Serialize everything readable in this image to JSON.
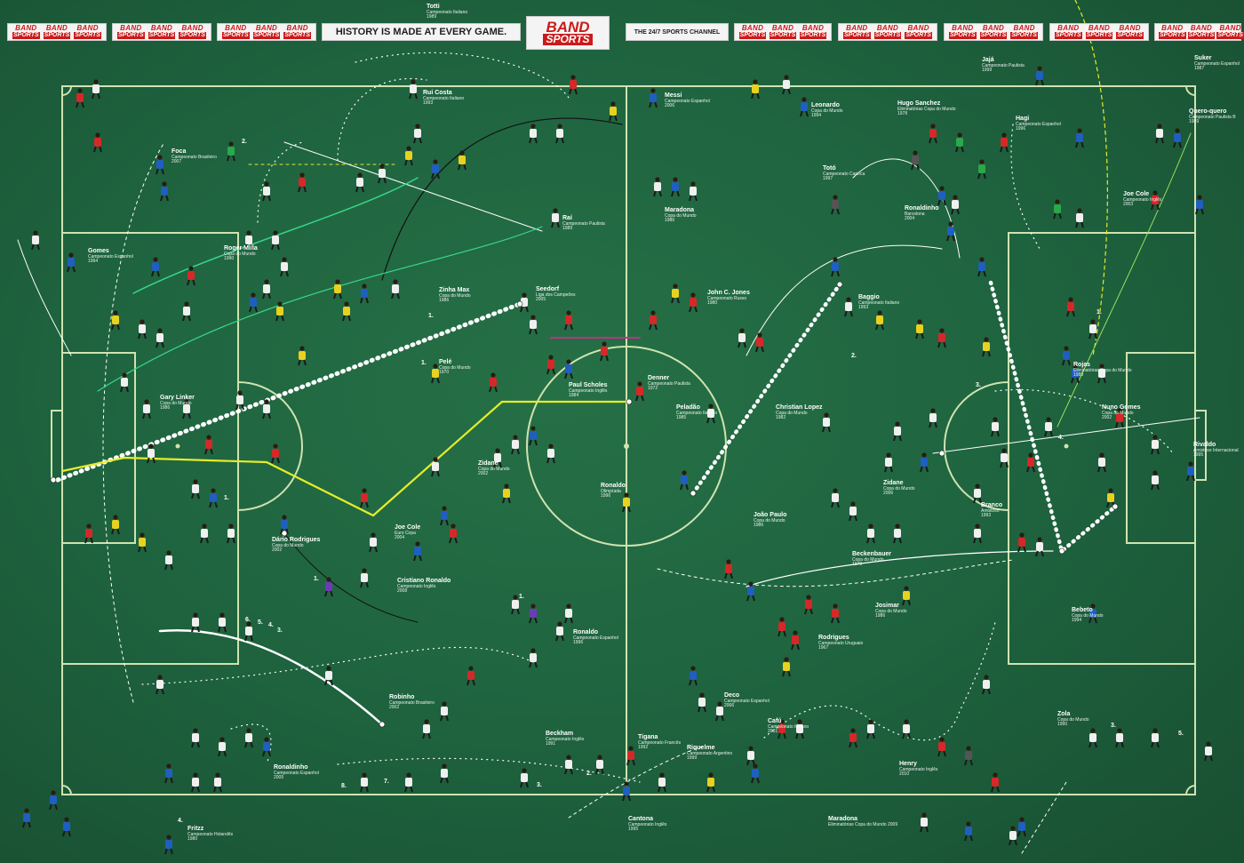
{
  "header": {
    "tagline_left": "HISTORY IS MADE AT EVERY GAME.",
    "tagline_right": "THE 24/7 SPORTS CHANNEL",
    "brand_top": "BAND",
    "brand_bottom": "SPORTS",
    "brand_color": "#cc1a1a"
  },
  "colors": {
    "pitch": "#1f6540",
    "lines": "#cfe3b0",
    "pass_white": "#ffffff",
    "pass_yellow": "#e6ec2a"
  },
  "labels": [
    {
      "id": "totti",
      "name": "Totti",
      "comp": "Campeonato Italiano",
      "year": "1989"
    },
    {
      "id": "rui-costa",
      "name": "Rui Costa",
      "comp": "Campeonato Italiano",
      "year": "1993"
    },
    {
      "id": "messi",
      "name": "Messi",
      "comp": "Campeonato Espanhol",
      "year": "2006"
    },
    {
      "id": "leonardo",
      "name": "Leonardo",
      "comp": "Copa do Mundo",
      "year": "1994"
    },
    {
      "id": "hugo-sanchez",
      "name": "Hugo Sanchez",
      "comp": "Eliminatórias Copa do Mundo",
      "year": "1978"
    },
    {
      "id": "hagi",
      "name": "Hagi",
      "comp": "Campeonato Espanhol",
      "year": "1996"
    },
    {
      "id": "jaja",
      "name": "Jajá",
      "comp": "Campeonato Paulista",
      "year": "1999"
    },
    {
      "id": "suker",
      "name": "Suker",
      "comp": "Campeonato Espanhol",
      "year": "1987"
    },
    {
      "id": "quero-quero",
      "name": "Quero-quero",
      "comp": "Campeonato Paulista B",
      "year": "1989"
    },
    {
      "id": "foca",
      "name": "Foca",
      "comp": "Campeonato Brasileiro",
      "year": "2007"
    },
    {
      "id": "toto",
      "name": "Totó",
      "comp": "Campeonato Carioca",
      "year": "1997"
    },
    {
      "id": "rai",
      "name": "Raí",
      "comp": "Campeonato Paulista",
      "year": "1989"
    },
    {
      "id": "maradona-1986",
      "name": "Maradona",
      "comp": "Copa do Mundo",
      "year": "1986"
    },
    {
      "id": "ronaldinho-barcelona",
      "name": "Ronaldinho",
      "comp": "Barcelona",
      "year": "2004"
    },
    {
      "id": "joe-cole-ingles",
      "name": "Joe Cole",
      "comp": "Campeonato Inglês",
      "year": "2003"
    },
    {
      "id": "gomes",
      "name": "Gomes",
      "comp": "Campeonato Espanhol",
      "year": "1994"
    },
    {
      "id": "roger-milla",
      "name": "Roger Milla",
      "comp": "Copa do Mundo",
      "year": "1990"
    },
    {
      "id": "zinha-max",
      "name": "Zinha Max",
      "comp": "Copa do Mundo",
      "year": "1986"
    },
    {
      "id": "seedorf",
      "name": "Seedorf",
      "comp": "Liga dos Campeões",
      "year": "2005"
    },
    {
      "id": "john-c-jones",
      "name": "John C. Jones",
      "comp": "Campeonato Russo",
      "year": "1980"
    },
    {
      "id": "baggio",
      "name": "Baggio",
      "comp": "Campeonato Italiano",
      "year": "1993"
    },
    {
      "id": "pele",
      "name": "Pelé",
      "comp": "Copa do Mundo",
      "year": "1970"
    },
    {
      "id": "paul-scholes",
      "name": "Paul Scholes",
      "comp": "Campeonato Inglês",
      "year": "1984"
    },
    {
      "id": "denner",
      "name": "Denner",
      "comp": "Campeonato Paulista",
      "year": "1972"
    },
    {
      "id": "peladao",
      "name": "Peladão",
      "comp": "Campeonato Italiano",
      "year": "1985"
    },
    {
      "id": "christian-lopez",
      "name": "Christian Lopez",
      "comp": "Copa do Mundo",
      "year": "1982"
    },
    {
      "id": "rojas",
      "name": "Rojas",
      "comp": "Eliminatórias Copa do Mundo",
      "year": "1989"
    },
    {
      "id": "nuno-gomes",
      "name": "Nuno Gomes",
      "comp": "Copa do Mundo",
      "year": "2002"
    },
    {
      "id": "gary-linker",
      "name": "Gary Linker",
      "comp": "Copa do Mundo",
      "year": "1986"
    },
    {
      "id": "zidane-2002",
      "name": "Zidane",
      "comp": "Copa do Mundo",
      "year": "2002"
    },
    {
      "id": "ronaldo-olimpiada",
      "name": "Ronaldo",
      "comp": "Olimpíada",
      "year": "1996"
    },
    {
      "id": "zidane-2006",
      "name": "Zidane",
      "comp": "Copa do Mundo",
      "year": "2006"
    },
    {
      "id": "branco",
      "name": "Branco",
      "comp": "Amistoso",
      "year": "1993"
    },
    {
      "id": "rivaldo",
      "name": "Rivaldo",
      "comp": "Amistoso Internacional",
      "year": "1995"
    },
    {
      "id": "joao-paulo",
      "name": "João Paulo",
      "comp": "Copa do Mundo",
      "year": "1986"
    },
    {
      "id": "dario-rodrigues",
      "name": "Dário Rodrigues",
      "comp": "Copa do Mundo",
      "year": "2002"
    },
    {
      "id": "joe-cole-euro",
      "name": "Joe Cole",
      "comp": "Euro Copa",
      "year": "2004"
    },
    {
      "id": "beckenbauer",
      "name": "Beckenbauer",
      "comp": "Copa do Mundo",
      "year": "1970"
    },
    {
      "id": "cristiano-ronaldo",
      "name": "Cristiano Ronaldo",
      "comp": "Campeonato Inglês",
      "year": "2008"
    },
    {
      "id": "josimar",
      "name": "Josimar",
      "comp": "Copa do Mundo",
      "year": "1986"
    },
    {
      "id": "rodrigues",
      "name": "Rodrigues",
      "comp": "Campeonato Uruguaio",
      "year": "1967"
    },
    {
      "id": "ronaldo-espanhol",
      "name": "Ronaldo",
      "comp": "Campeonato Espanhol",
      "year": "1996"
    },
    {
      "id": "bebeto",
      "name": "Bebeto",
      "comp": "Copa do Mundo",
      "year": "1994"
    },
    {
      "id": "robinho",
      "name": "Robinho",
      "comp": "Campeonato Brasileiro",
      "year": "2002"
    },
    {
      "id": "deco",
      "name": "Deco",
      "comp": "Campeonato Espanhol",
      "year": "2006"
    },
    {
      "id": "cafu",
      "name": "Cafú",
      "comp": "Campeonato Italiano",
      "year": "2001"
    },
    {
      "id": "beckham",
      "name": "Beckham",
      "comp": "Campeonato Inglês",
      "year": "1991"
    },
    {
      "id": "tigana",
      "name": "Tigana",
      "comp": "Campeonato Francês",
      "year": "1992"
    },
    {
      "id": "riquelme",
      "name": "Riquelme",
      "comp": "Campeonato Argentino",
      "year": "1999"
    },
    {
      "id": "zola",
      "name": "Zola",
      "comp": "Copa do Mundo",
      "year": "1990"
    },
    {
      "id": "henry",
      "name": "Henry",
      "comp": "Campeonato Inglês",
      "year": "2010"
    },
    {
      "id": "ronaldinho-espanhol",
      "name": "Ronaldinho",
      "comp": "Campeonato Espanhol",
      "year": "2005"
    },
    {
      "id": "cantona",
      "name": "Cantona",
      "comp": "Campeonato Inglês",
      "year": "1995"
    },
    {
      "id": "maradona-2009",
      "name": "Maradona",
      "comp": "Eliminatórias Copa do Mundo 2009",
      "year": ""
    },
    {
      "id": "fritzz",
      "name": "Fritzz",
      "comp": "Campeonato Holandês",
      "year": "1980"
    }
  ],
  "sequence_numbers": [
    "1.",
    "2.",
    "3.",
    "4.",
    "5.",
    "6.",
    "7.",
    "8."
  ]
}
